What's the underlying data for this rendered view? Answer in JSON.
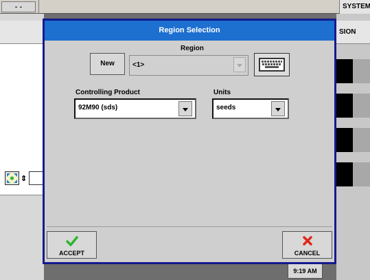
{
  "background": {
    "top_left_button": "- -",
    "system_label": "SYSTEM",
    "right_header": "SION",
    "time": "9:19 AM",
    "arrows_label": "⇕"
  },
  "dialog": {
    "title": "Region Selection",
    "region": {
      "label": "Region",
      "new_button": "New",
      "value": "<1>"
    },
    "controlling_product": {
      "label": "Controlling Product",
      "value": "92M90 (sds)"
    },
    "units": {
      "label": "Units",
      "value": "seeds"
    },
    "accept_label": "ACCEPT",
    "cancel_label": "CANCEL"
  },
  "colors": {
    "title_bar": "#1d6fd0",
    "dialog_border": "#141a8c",
    "accept_check": "#2fb52f",
    "cancel_x": "#e0281e"
  },
  "icons": [
    "keyboard-icon",
    "checkmark-icon",
    "x-icon",
    "expand-arrows-icon"
  ]
}
